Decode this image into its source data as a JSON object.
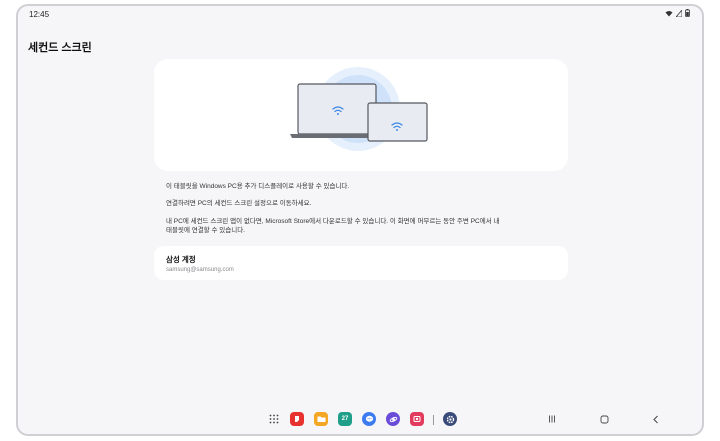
{
  "status_bar": {
    "time": "12:45"
  },
  "page": {
    "title": "세컨드 스크린"
  },
  "description": {
    "line1": "이 태블릿을 Windows PC용 추가 디스플레이로 사용할 수 있습니다.",
    "line2": "연결하려면 PC의 세컨드 스크린 설정으로 이동하세요.",
    "line3a": "내 PC에 세컨드 스크린 앱이 없다면, Microsoft Store에서 다운로드할 수 있습니다. 이 화면에 머무르는 동안 주변 PC에서 내",
    "line3b": "태블릿에 연결할 수 있습니다."
  },
  "account": {
    "title": "삼성 계정",
    "email": "samsung@samsung.com"
  },
  "colors": {
    "accent": "#3f8be6",
    "background": "#f6f6f8",
    "card": "#ffffff"
  },
  "dock": {
    "apps": [
      {
        "name": "app-drawer-icon"
      },
      {
        "name": "samsung-notes-icon",
        "color": "#e8322f"
      },
      {
        "name": "my-files-icon",
        "color": "#f5a623"
      },
      {
        "name": "calendar-icon",
        "color": "#1f9e8a",
        "text": "27"
      },
      {
        "name": "messages-icon",
        "color": "#3d7bf0"
      },
      {
        "name": "internet-icon",
        "color": "#6a4cd8"
      },
      {
        "name": "screen-recorder-icon",
        "color": "#e23b5e"
      },
      {
        "name": "settings-icon",
        "color": "#3a4b7a"
      }
    ]
  }
}
